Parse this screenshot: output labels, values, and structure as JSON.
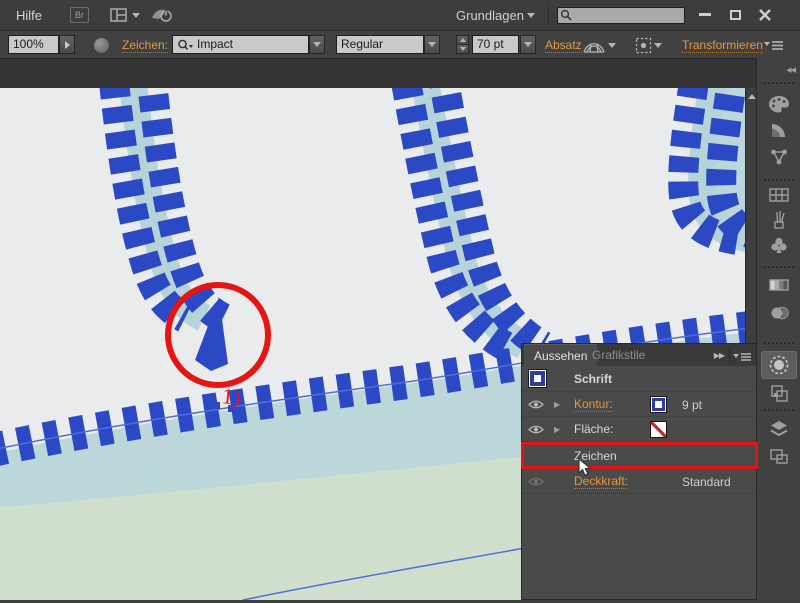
{
  "menubar": {
    "menu_hilfe": "Hilfe",
    "bridge_label": "Br",
    "workspace_label": "Grundlagen",
    "search_value": ""
  },
  "controlbar": {
    "zoom_value": "100%",
    "zeichen_link": "Zeichen:",
    "font_name": "Impact",
    "font_style": "Regular",
    "font_size": "70 pt",
    "absatz_link": "Absatz",
    "transform_link": "Transformieren"
  },
  "canvas": {
    "annotation_label": "1)"
  },
  "panel": {
    "tab_aussehen": "Aussehen",
    "tab_grafikstile": "Grafikstile",
    "rows": {
      "schrift": "Schrift",
      "kontur_label": "Kontur:",
      "kontur_value": "9 pt",
      "flaeche_label": "Fläche:",
      "zeichen_label": "Zeichen",
      "deckkraft_label": "Deckkraft:",
      "deckkraft_value": "Standard"
    }
  },
  "dock": {
    "icons": [
      "color",
      "color-guide",
      "color-themes",
      "swatches",
      "brushes",
      "symbols",
      "gradient",
      "transparency",
      "appearance",
      "graphic-styles",
      "layers",
      "artboards"
    ]
  },
  "colors": {
    "accent_orange": "#e8963a",
    "tie_blue": "#2b49c4",
    "track_teal": "#b5d3d8",
    "water_teal": "#bcd7d9",
    "land_green": "#cfdecd",
    "annotation_red": "#e81313"
  }
}
